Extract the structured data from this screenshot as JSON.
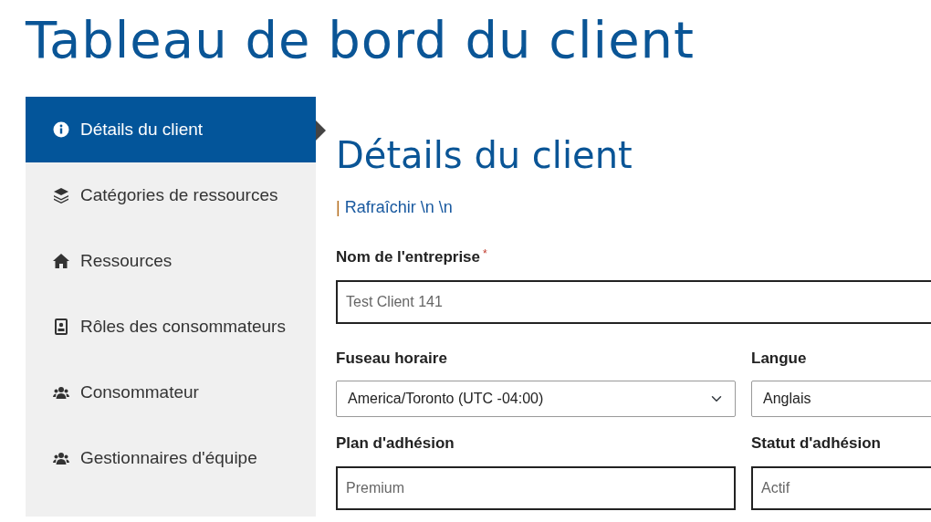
{
  "page_title": "Tableau de bord du client",
  "sidebar": {
    "items": [
      {
        "label": "Détails du client",
        "selected": true
      },
      {
        "label": "Catégories de ressources",
        "selected": false
      },
      {
        "label": "Ressources",
        "selected": false
      },
      {
        "label": "Rôles des consommateurs",
        "selected": false
      },
      {
        "label": "Consommateur",
        "selected": false
      },
      {
        "label": "Gestionnaires d'équipe",
        "selected": false
      }
    ]
  },
  "section": {
    "title": "Détails du client",
    "toolbar": {
      "separator": "|",
      "link": "Rafraîchir \\n \\n"
    },
    "field_rows": [
      [
        {
          "kind": "text",
          "label": "Nom de l'entreprise",
          "required_mark": "*",
          "value": "Test Client 141"
        }
      ],
      [
        {
          "kind": "select",
          "label": "Fuseau horaire",
          "value": "America/Toronto (UTC -04:00)"
        },
        {
          "kind": "select",
          "label": "Langue",
          "value": "Anglais"
        }
      ],
      [
        {
          "kind": "text",
          "label": "Plan d'adhésion",
          "value": "Premium"
        },
        {
          "kind": "text",
          "label": "Statut d'adhésion",
          "value": "Actif"
        }
      ]
    ]
  }
}
